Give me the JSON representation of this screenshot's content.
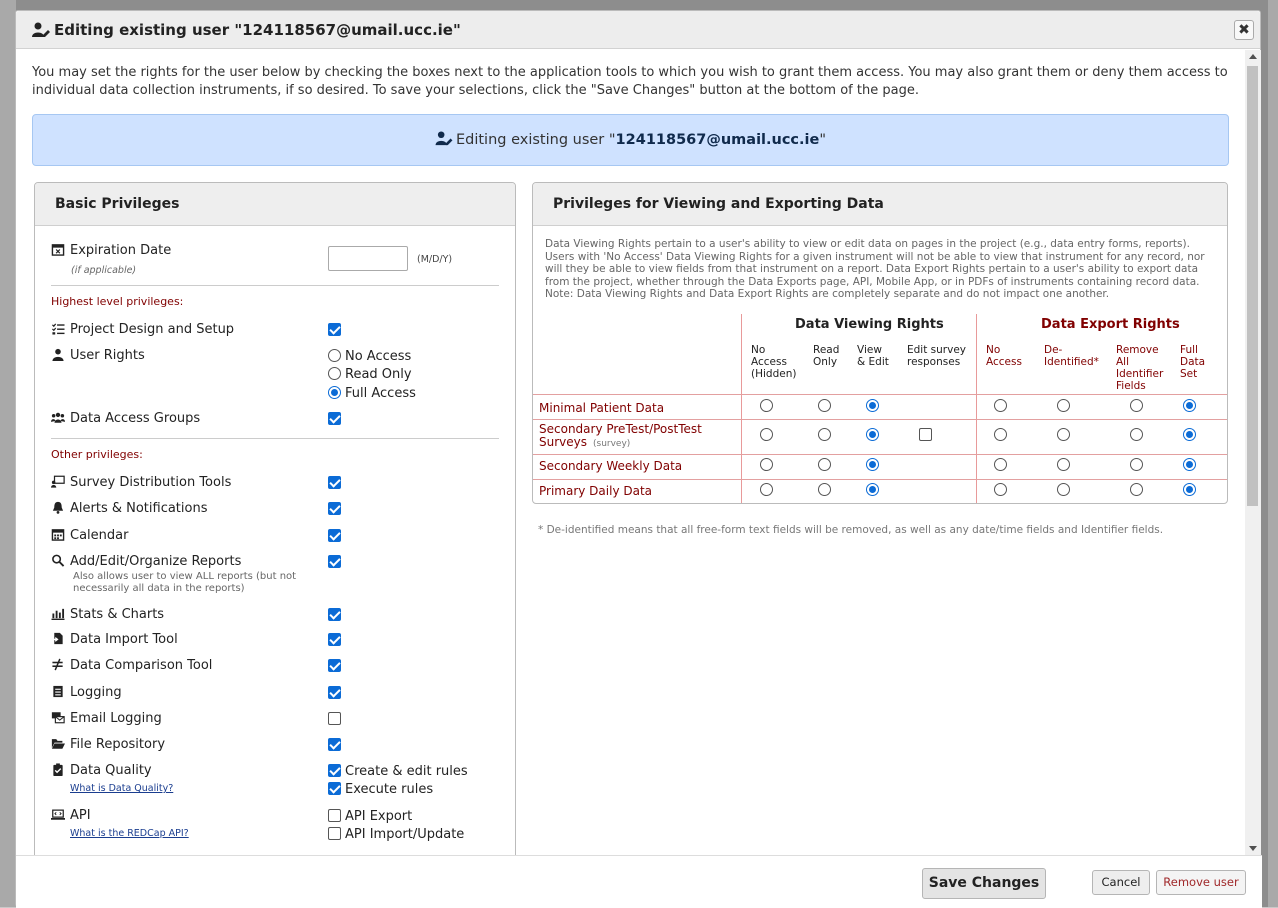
{
  "dialog": {
    "title": "Editing existing user \"124118567@umail.ucc.ie\"",
    "close_label": "✖",
    "intro": "You may set the rights for the user below by checking the boxes next to the application tools to which you wish to grant them access. You may also grant them or deny them access to individual data collection instruments, if so desired. To save your selections, click the \"Save Changes\" button at the bottom of the page.",
    "banner_prefix": "Editing existing user \"",
    "banner_user": "124118567@umail.ucc.ie",
    "banner_suffix": "\""
  },
  "basic": {
    "title": "Basic Privileges",
    "expiration_label": "Expiration Date",
    "expiration_sub": "(if applicable)",
    "expiration_value": "",
    "expiration_hint": "(M/D/Y)",
    "highest_label": "Highest level privileges:",
    "other_label": "Other privileges:",
    "project_design": {
      "label": "Project Design and Setup",
      "checked": true
    },
    "user_rights": {
      "label": "User Rights",
      "options": [
        "No Access",
        "Read Only",
        "Full Access"
      ],
      "selected": "Full Access"
    },
    "data_access_groups": {
      "label": "Data Access Groups",
      "checked": true
    },
    "survey_tools": {
      "label": "Survey Distribution Tools",
      "checked": true
    },
    "alerts": {
      "label": "Alerts & Notifications",
      "checked": true
    },
    "calendar": {
      "label": "Calendar",
      "checked": true
    },
    "reports": {
      "label": "Add/Edit/Organize Reports",
      "note": "Also allows user to view ALL reports (but not necessarily all data in the reports)",
      "checked": true
    },
    "stats": {
      "label": "Stats & Charts",
      "checked": true
    },
    "import": {
      "label": "Data Import Tool",
      "checked": true
    },
    "comparison": {
      "label": "Data Comparison Tool",
      "checked": true
    },
    "logging": {
      "label": "Logging",
      "checked": true
    },
    "email_logging": {
      "label": "Email Logging",
      "checked": false
    },
    "file_repo": {
      "label": "File Repository",
      "checked": true
    },
    "data_quality": {
      "label": "Data Quality",
      "link": "What is Data Quality?",
      "opt1": "Create & edit rules",
      "opt1_checked": true,
      "opt2": "Execute rules",
      "opt2_checked": true
    },
    "api": {
      "label": "API",
      "link": "What is the REDCap API?",
      "opt1": "API Export",
      "opt1_checked": false,
      "opt2": "API Import/Update",
      "opt2_checked": false
    }
  },
  "viewing": {
    "title": "Privileges for Viewing and Exporting Data",
    "description": "Data Viewing Rights pertain to a user's ability to view or edit data on pages in the project (e.g., data entry forms, reports). Users with 'No Access' Data Viewing Rights for a given instrument will not be able to view that instrument for any record, nor will they be able to view fields from that instrument on a report. Data Export Rights pertain to a user's ability to export data from the project, whether through the Data Exports page, API, Mobile App, or in PDFs of instruments containing record data. Note: Data Viewing Rights and Data Export Rights are completely separate and do not impact one another.",
    "view_group": "Data Viewing Rights",
    "export_group": "Data Export Rights",
    "view_cols": [
      "No Access (Hidden)",
      "Read Only",
      "View & Edit",
      "Edit survey responses"
    ],
    "export_cols": [
      "No Access",
      "De-Identified*",
      "Remove All Identifier Fields",
      "Full Data Set"
    ],
    "rows": [
      {
        "name": "Minimal Patient Data",
        "survey": "",
        "view": "View & Edit",
        "edit_survey": null,
        "export": "Full Data Set"
      },
      {
        "name": "Secondary PreTest/PostTest Surveys",
        "survey": "(survey)",
        "view": "View & Edit",
        "edit_survey": false,
        "export": "Full Data Set"
      },
      {
        "name": "Secondary Weekly Data",
        "survey": "",
        "view": "View & Edit",
        "edit_survey": null,
        "export": "Full Data Set"
      },
      {
        "name": "Primary Daily Data",
        "survey": "",
        "view": "View & Edit",
        "edit_survey": null,
        "export": "Full Data Set"
      }
    ],
    "footnote": "* De-identified means that all free-form text fields will be removed, as well as any date/time fields and Identifier fields.",
    "view_color": "#000000",
    "export_color": "#800000"
  },
  "footer": {
    "save": "Save Changes",
    "cancel": "Cancel",
    "remove": "Remove user"
  }
}
